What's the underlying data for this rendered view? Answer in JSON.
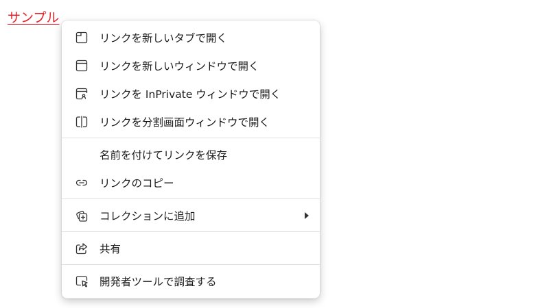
{
  "page": {
    "link_text": "サンプル"
  },
  "menu": {
    "items": [
      {
        "label": "リンクを新しいタブで開く",
        "icon": "new-tab-icon"
      },
      {
        "label": "リンクを新しいウィンドウで開く",
        "icon": "new-window-icon"
      },
      {
        "label": "リンクを InPrivate ウィンドウで開く",
        "icon": "inprivate-window-icon"
      },
      {
        "label": "リンクを分割画面ウィンドウで開く",
        "icon": "split-screen-icon"
      },
      {
        "label": "名前を付けてリンクを保存",
        "icon": ""
      },
      {
        "label": "リンクのコピー",
        "icon": "link-icon"
      },
      {
        "label": "コレクションに追加",
        "icon": "add-collection-icon",
        "submenu": true
      },
      {
        "label": "共有",
        "icon": "share-icon"
      },
      {
        "label": "開発者ツールで調査する",
        "icon": "inspect-icon"
      }
    ]
  },
  "colors": {
    "link": "#e8242d",
    "text": "#1b1b1b",
    "separator": "#e1e1e1"
  }
}
